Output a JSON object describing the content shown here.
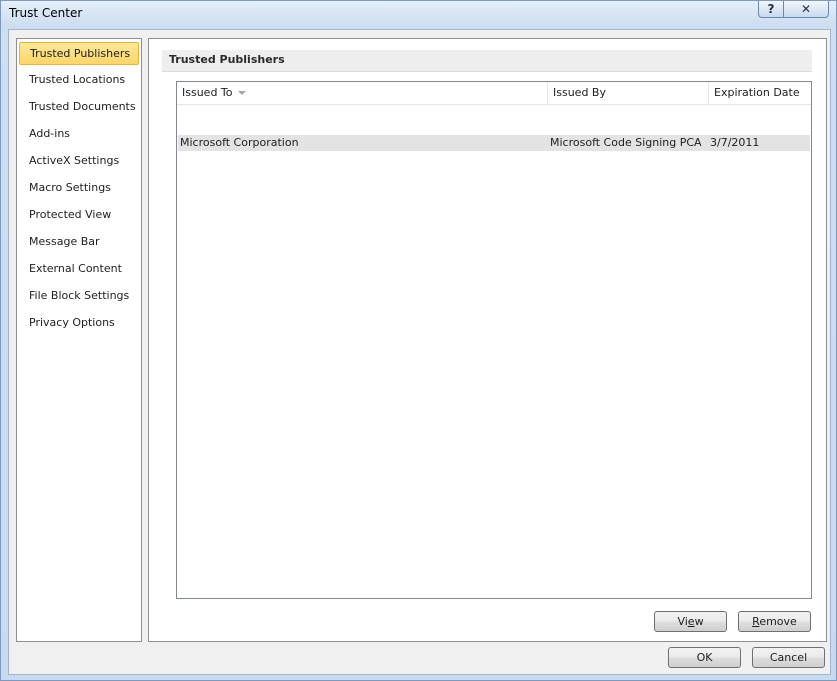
{
  "window": {
    "title": "Trust Center",
    "help_glyph": "?",
    "close_glyph": "✕"
  },
  "sidebar": {
    "items": [
      {
        "label": "Trusted Publishers",
        "selected": true
      },
      {
        "label": "Trusted Locations",
        "selected": false
      },
      {
        "label": "Trusted Documents",
        "selected": false
      },
      {
        "label": "Add-ins",
        "selected": false
      },
      {
        "label": "ActiveX Settings",
        "selected": false
      },
      {
        "label": "Macro Settings",
        "selected": false
      },
      {
        "label": "Protected View",
        "selected": false
      },
      {
        "label": "Message Bar",
        "selected": false
      },
      {
        "label": "External Content",
        "selected": false
      },
      {
        "label": "File Block Settings",
        "selected": false
      },
      {
        "label": "Privacy Options",
        "selected": false
      }
    ]
  },
  "main": {
    "section_title": "Trusted Publishers",
    "table": {
      "columns": [
        "Issued To",
        "Issued By",
        "Expiration Date"
      ],
      "rows": [
        {
          "issued_to": "Microsoft Corporation",
          "issued_by": "Microsoft Code Signing PCA",
          "expiration": "3/7/2011"
        }
      ]
    },
    "buttons": {
      "view_prefix": "Vi",
      "view_underlined": "e",
      "view_suffix": "w",
      "remove_underlined": "R",
      "remove_suffix": "emove"
    }
  },
  "footer": {
    "ok_label": "OK",
    "cancel_label": "Cancel"
  },
  "colors": {
    "selected_item_bg": "#fcd56b",
    "selected_row_bg": "#e3e3e3"
  }
}
